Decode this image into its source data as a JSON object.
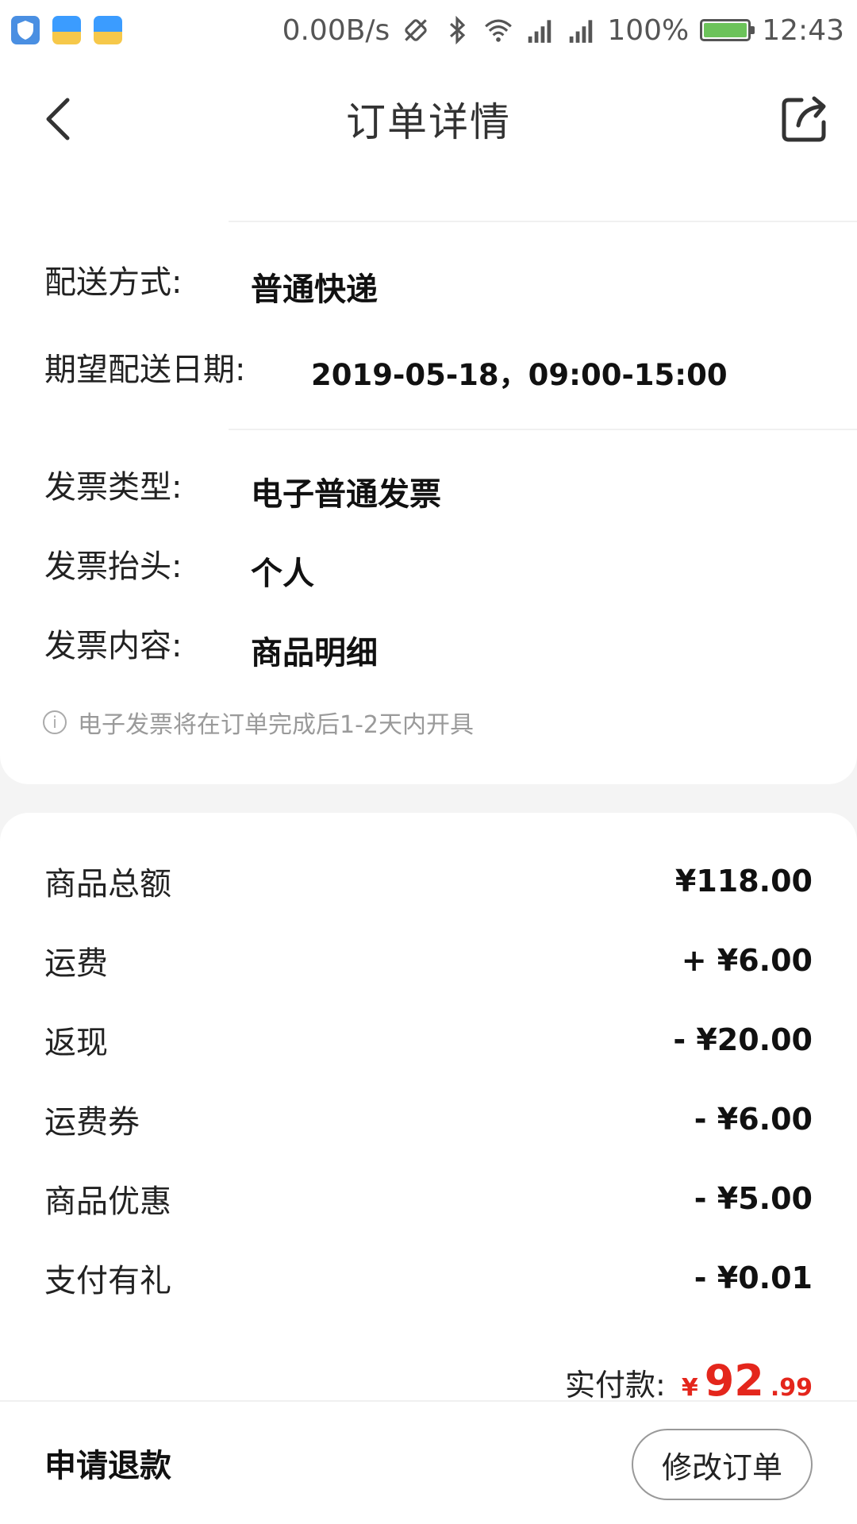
{
  "status_bar": {
    "net_speed": "0.00B/s",
    "battery": "100%",
    "time": "12:43"
  },
  "nav": {
    "title": "订单详情"
  },
  "delivery": {
    "method_label": "配送方式:",
    "method_value": "普通快递",
    "date_label": "期望配送日期:",
    "date_value": "2019-05-18，09:00-15:00"
  },
  "invoice": {
    "type_label": "发票类型:",
    "type_value": "电子普通发票",
    "header_label": "发票抬头:",
    "header_value": "个人",
    "content_label": "发票内容:",
    "content_value": "商品明细",
    "note": "电子发票将在订单完成后1-2天内开具"
  },
  "fees": [
    {
      "label": "商品总额",
      "value": "¥118.00"
    },
    {
      "label": "运费",
      "value": "+ ¥6.00"
    },
    {
      "label": "返现",
      "value": "- ¥20.00"
    },
    {
      "label": "运费券",
      "value": "- ¥6.00"
    },
    {
      "label": "商品优惠",
      "value": "- ¥5.00"
    },
    {
      "label": "支付有礼",
      "value": "- ¥0.01"
    }
  ],
  "total": {
    "label": "实付款:",
    "currency": "¥",
    "integer": "92",
    "decimal": ".99"
  },
  "actions": {
    "refund": "申请退款",
    "modify": "修改订单"
  },
  "colors": {
    "accent_red": "#e4261c",
    "battery_green": "#6cc35a"
  }
}
